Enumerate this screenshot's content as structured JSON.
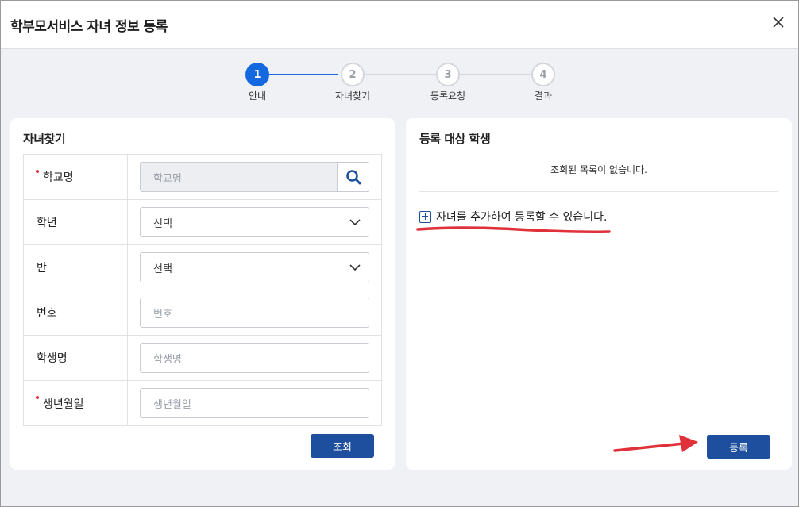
{
  "dialog": {
    "title": "학부모서비스 자녀 정보 등록",
    "close_icon": "close-icon"
  },
  "stepper": {
    "steps": [
      {
        "number": "1",
        "label": "안내",
        "active": true
      },
      {
        "number": "2",
        "label": "자녀찾기",
        "active": false
      },
      {
        "number": "3",
        "label": "등록요청",
        "active": false
      },
      {
        "number": "4",
        "label": "결과",
        "active": false
      }
    ]
  },
  "search_panel": {
    "title": "자녀찾기",
    "rows": [
      {
        "label": "학교명",
        "required": true,
        "placeholder": "학교명",
        "type": "search"
      },
      {
        "label": "학년",
        "required": false,
        "value": "선택",
        "type": "select"
      },
      {
        "label": "반",
        "required": false,
        "value": "선택",
        "type": "select"
      },
      {
        "label": "번호",
        "required": false,
        "placeholder": "번호",
        "type": "text"
      },
      {
        "label": "학생명",
        "required": false,
        "placeholder": "학생명",
        "type": "text"
      },
      {
        "label": "생년월일",
        "required": true,
        "placeholder": "생년월일",
        "type": "text"
      }
    ],
    "search_button": "조회"
  },
  "target_panel": {
    "title": "등록 대상 학생",
    "empty_message": "조회된 목록이 없습니다.",
    "add_text": "자녀를 추가하여 등록할 수 있습니다.",
    "register_button": "등록"
  },
  "colors": {
    "primary": "#1d4f9e",
    "step_active": "#1569e0",
    "annotation_red": "#e0303a"
  }
}
